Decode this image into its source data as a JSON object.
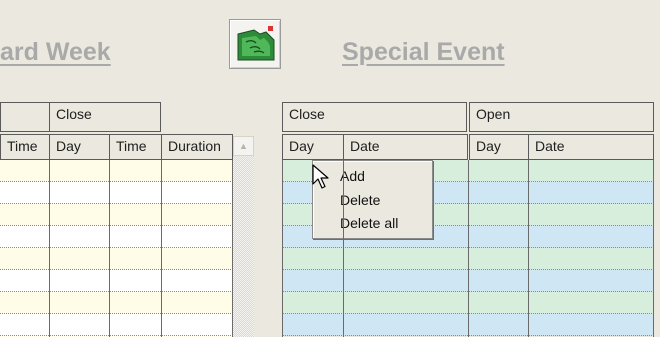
{
  "titles": {
    "standard_week": "ard Week",
    "special_event": "Special Event"
  },
  "toolbar_icon": "hand-gesture-icon",
  "left_table": {
    "group_header": "Close",
    "columns": [
      "Time",
      "Day",
      "Time",
      "Duration"
    ]
  },
  "right_table": {
    "group_close": "Close",
    "group_open": "Open",
    "columns": [
      "Day",
      "Date",
      "Day",
      "Date"
    ]
  },
  "context_menu": {
    "items": [
      "Add",
      "Delete",
      "Delete all"
    ]
  },
  "colors": {
    "left_row_a": "#fffde8",
    "left_row_b": "#ffffff",
    "right_row_a": "#d8eedc",
    "right_row_b": "#cfe6f4"
  }
}
